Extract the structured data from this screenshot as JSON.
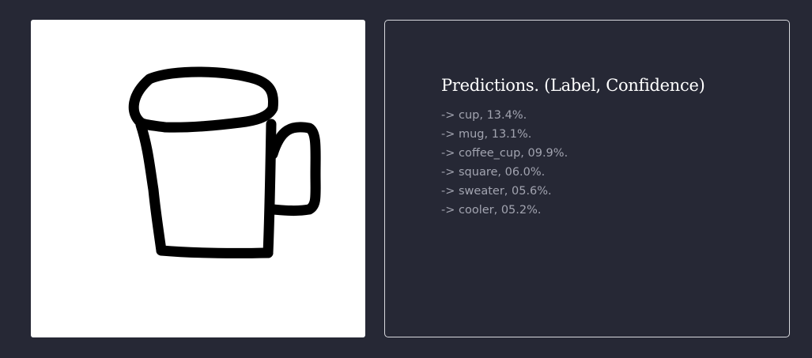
{
  "predictions": {
    "title": "Predictions. (Label, Confidence)",
    "items": [
      "-> cup, 13.4%.",
      "-> mug, 13.1%.",
      "-> coffee_cup, 09.9%.",
      "-> square, 06.0%.",
      "-> sweater, 05.6%.",
      "-> cooler, 05.2%."
    ]
  },
  "drawing": {
    "subject": "hand-drawn mug sketch",
    "stroke_color": "#000000",
    "background_color": "#ffffff"
  }
}
